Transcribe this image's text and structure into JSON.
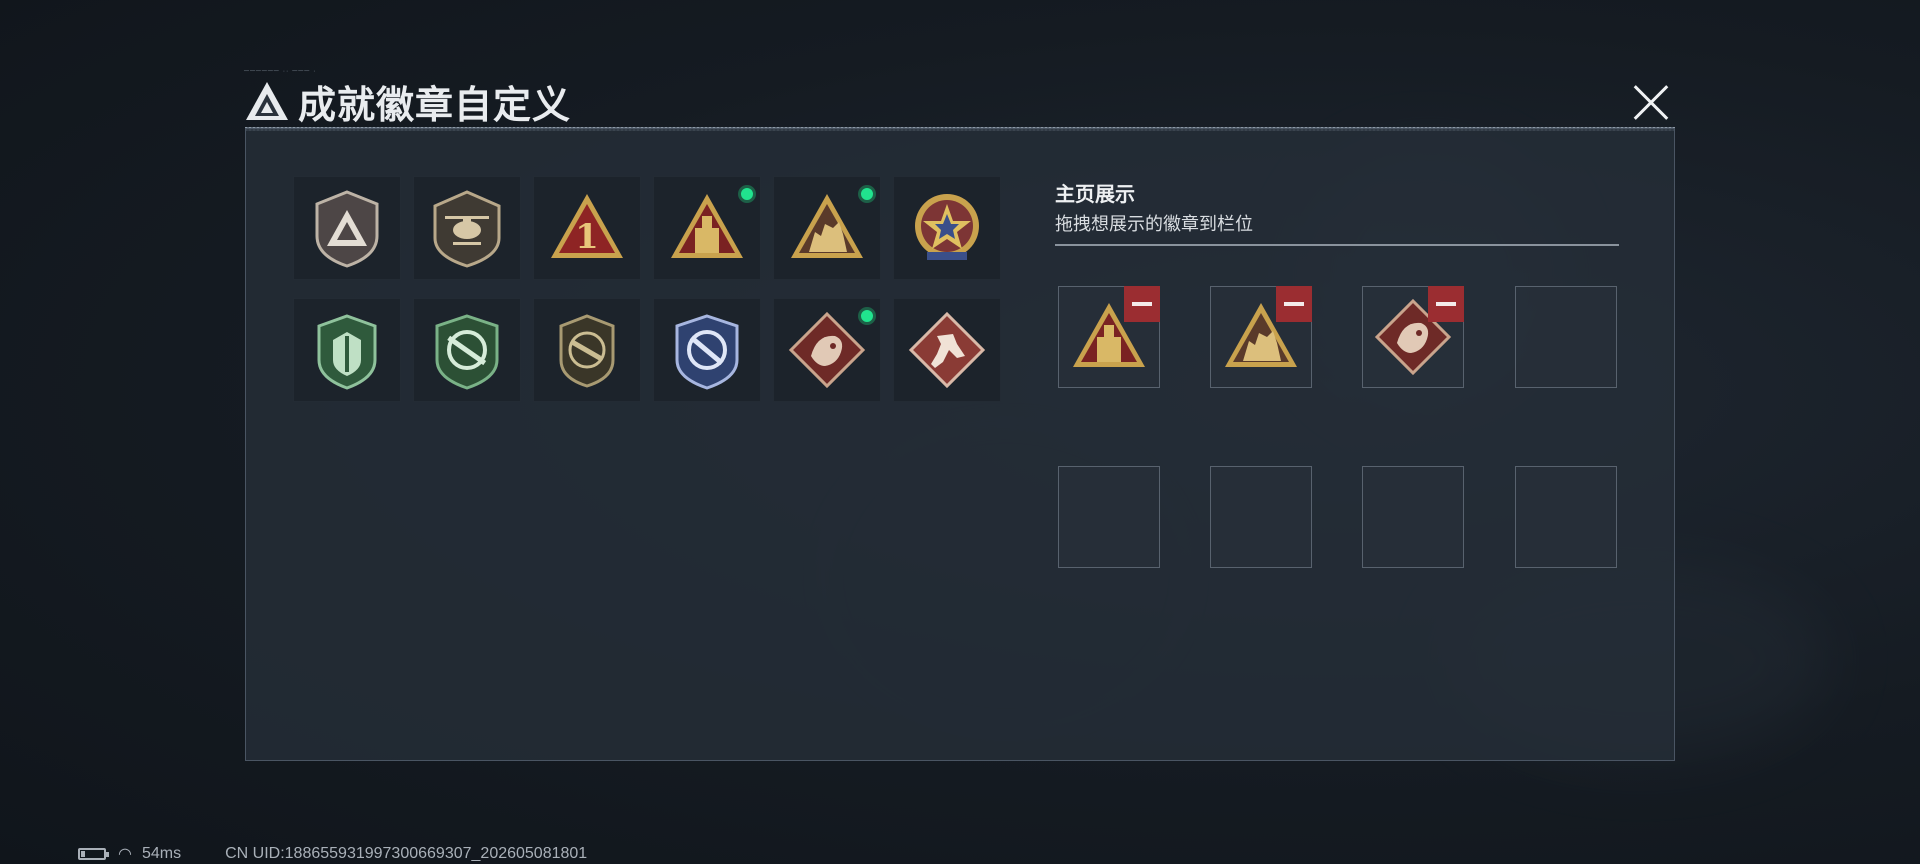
{
  "header": {
    "title": "成就徽章自定义",
    "deco_text": "────── ·· ─── ·"
  },
  "badges": [
    {
      "icon": "silver-triangle-shield-badge-icon",
      "selected": false
    },
    {
      "icon": "helicopter-shield-badge-icon",
      "selected": false
    },
    {
      "icon": "number-one-triangle-badge-icon",
      "selected": false
    },
    {
      "icon": "gold-tower-triangle-badge-icon",
      "selected": true
    },
    {
      "icon": "soldiers-triangle-badge-icon",
      "selected": true
    },
    {
      "icon": "star-medal-badge-icon",
      "selected": false
    },
    {
      "icon": "green-wings-shield-badge-icon",
      "selected": false
    },
    {
      "icon": "green-crosshair-rifle-badge-icon",
      "selected": false
    },
    {
      "icon": "bronze-rifle-shield-badge-icon",
      "selected": false
    },
    {
      "icon": "blue-crosshair-knife-badge-icon",
      "selected": false
    },
    {
      "icon": "dragon-diamond-badge-icon",
      "selected": true
    },
    {
      "icon": "runner-diamond-badge-icon",
      "selected": false
    }
  ],
  "display": {
    "title": "主页展示",
    "subtitle": "拖拽想展示的徽章到栏位",
    "slots": [
      {
        "icon": "gold-tower-triangle-badge-icon",
        "filled": true
      },
      {
        "icon": "soldiers-triangle-badge-icon",
        "filled": true
      },
      {
        "icon": "dragon-diamond-badge-icon",
        "filled": true
      },
      {
        "filled": false
      },
      {
        "filled": false
      },
      {
        "filled": false
      },
      {
        "filled": false
      },
      {
        "filled": false
      }
    ]
  },
  "status": {
    "ping": "54ms",
    "uid": "CN UID:188655931997300669307_202605081801"
  },
  "colors": {
    "accent_green": "#21e38e",
    "remove_red": "#9b2d31",
    "panel_bg": "#262e38"
  }
}
